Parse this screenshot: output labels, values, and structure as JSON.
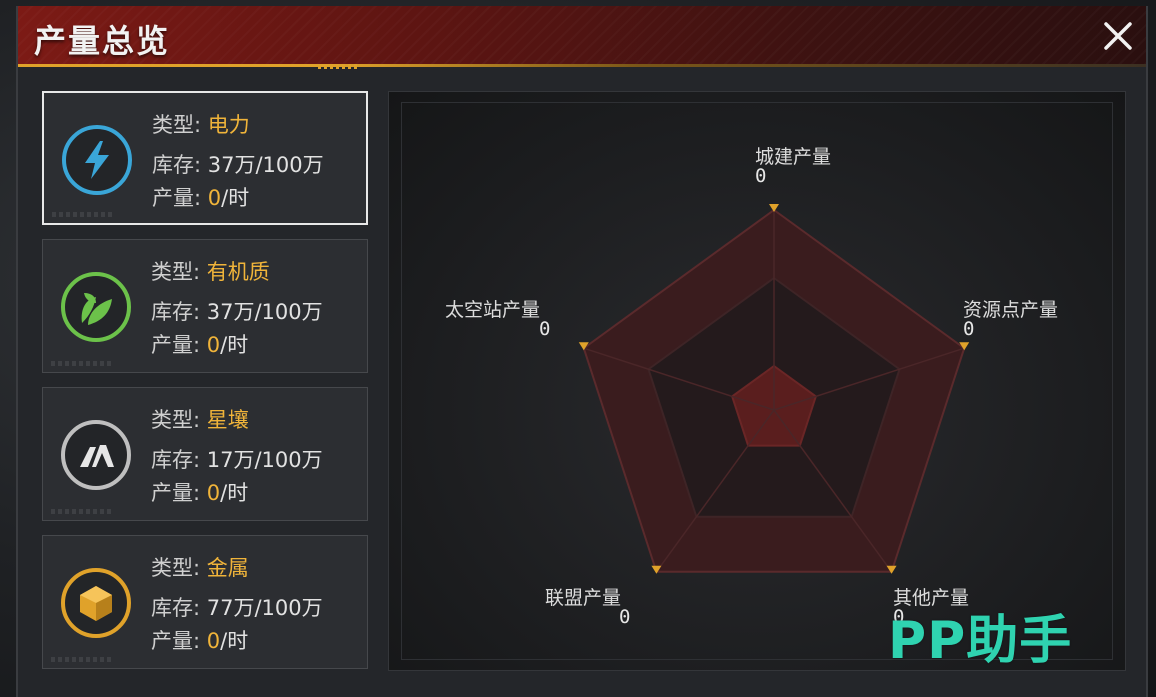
{
  "window": {
    "title": "产量总览"
  },
  "resources": [
    {
      "type_label": "类型:",
      "type_name": "电力",
      "stock_label": "库存:",
      "stock_value": "37万/100万",
      "output_label": "产量:",
      "output_value": "0",
      "output_unit": "/时",
      "icon": "lightning-icon",
      "color": "#3aa6d8",
      "selected": true
    },
    {
      "type_label": "类型:",
      "type_name": "有机质",
      "stock_label": "库存:",
      "stock_value": "37万/100万",
      "output_label": "产量:",
      "output_value": "0",
      "output_unit": "/时",
      "icon": "leaf-icon",
      "color": "#6cc24a",
      "selected": false
    },
    {
      "type_label": "类型:",
      "type_name": "星壤",
      "stock_label": "库存:",
      "stock_value": "17万/100万",
      "output_label": "产量:",
      "output_value": "0",
      "output_unit": "/时",
      "icon": "soil-block-icon",
      "color": "#bfbfbf",
      "selected": false
    },
    {
      "type_label": "类型:",
      "type_name": "金属",
      "stock_label": "库存:",
      "stock_value": "77万/100万",
      "output_label": "产量:",
      "output_value": "0",
      "output_unit": "/时",
      "icon": "metal-cube-icon",
      "color": "#e0a22a",
      "selected": false
    }
  ],
  "chart_data": {
    "type": "radar",
    "axes": [
      "城建产量",
      "资源点产量",
      "其他产量",
      "联盟产量",
      "太空站产量"
    ],
    "values": [
      0,
      0,
      0,
      0,
      0
    ]
  },
  "watermark": "PP助手",
  "colors": {
    "accent": "#e0a22a",
    "header_red": "#7c1a15",
    "radar_fill": "#5a1e1e"
  }
}
